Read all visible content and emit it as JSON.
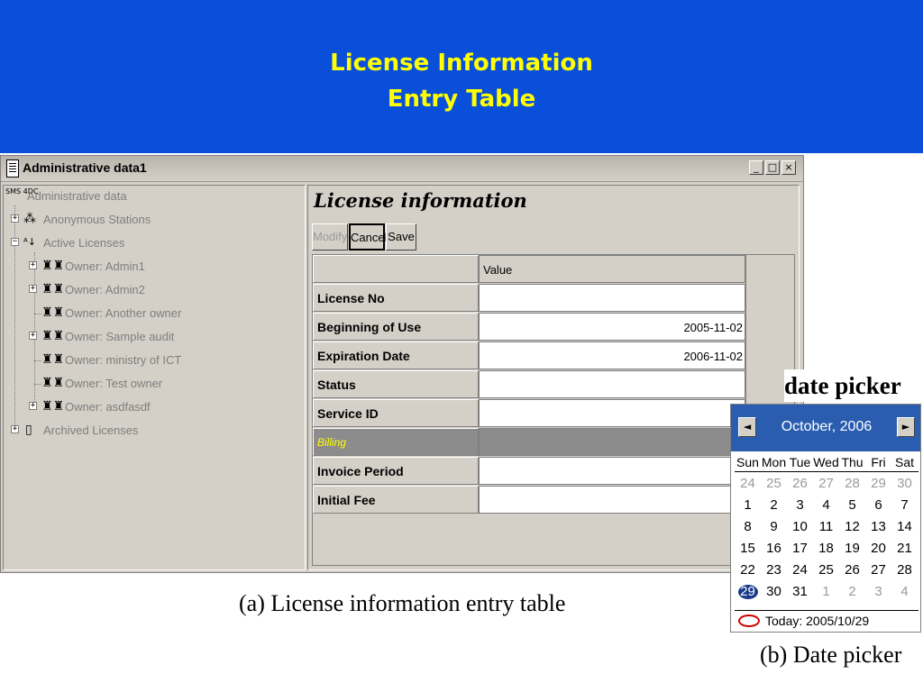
{
  "slide": {
    "title_line1": "License Information",
    "title_line2": "Entry Table",
    "header_color": "#0a4fd9",
    "title_color": "#ffff00"
  },
  "window": {
    "title": "Administrative data1",
    "controls": {
      "minimize": "_",
      "maximize": "□",
      "close": "×"
    }
  },
  "tree": {
    "root_icon_text": "SMS 4DC",
    "root": "Administrative data",
    "nodes": [
      {
        "label": "Anonymous Stations",
        "icon": "stations-icon",
        "expander": "+"
      },
      {
        "label": "Active Licenses",
        "icon": "active-licenses-icon",
        "expander": "−"
      },
      {
        "label": "Owner: Admin1",
        "icon": "owner-icon",
        "expander": "+"
      },
      {
        "label": "Owner: Admin2",
        "icon": "owner-icon",
        "expander": "+"
      },
      {
        "label": "Owner: Another owner",
        "icon": "owner-icon",
        "expander": ""
      },
      {
        "label": "Owner: Sample audit",
        "icon": "owner-icon",
        "expander": "+"
      },
      {
        "label": "Owner: ministry of ICT",
        "icon": "owner-icon",
        "expander": ""
      },
      {
        "label": "Owner: Test owner",
        "icon": "owner-icon",
        "expander": ""
      },
      {
        "label": "Owner: asdfasdf",
        "icon": "owner-icon",
        "expander": "+"
      },
      {
        "label": "Archived Licenses",
        "icon": "archive-icon",
        "expander": "+"
      }
    ]
  },
  "panel": {
    "title": "License information",
    "buttons": {
      "modify": "Modify",
      "cancel": "Cancel",
      "save": "Save"
    },
    "column_header": "Value",
    "rows": [
      {
        "label": "License No",
        "value": ""
      },
      {
        "label": "Beginning of Use",
        "value": "2005-11-02"
      },
      {
        "label": "Expiration Date",
        "value": "2006-11-02"
      },
      {
        "label": "Status",
        "value": ""
      },
      {
        "label": "Service ID",
        "value": ""
      },
      {
        "label": "Billing",
        "value": "",
        "section": true
      },
      {
        "label": "Invoice Period",
        "value": ""
      },
      {
        "label": "Initial Fee",
        "value": ""
      }
    ]
  },
  "captions": {
    "a": "(a) License information entry table",
    "b": "(b) Date picker",
    "date_picker_label": "date picker"
  },
  "datepicker": {
    "month": "October, 2006",
    "prev": "◄",
    "next": "►",
    "weekdays": [
      "Sun",
      "Mon",
      "Tue",
      "Wed",
      "Thu",
      "Fri",
      "Sat"
    ],
    "weeks": [
      [
        "24",
        "25",
        "26",
        "27",
        "28",
        "29",
        "30"
      ],
      [
        "1",
        "2",
        "3",
        "4",
        "5",
        "6",
        "7"
      ],
      [
        "8",
        "9",
        "10",
        "11",
        "12",
        "13",
        "14"
      ],
      [
        "15",
        "16",
        "17",
        "18",
        "19",
        "20",
        "21"
      ],
      [
        "22",
        "23",
        "24",
        "25",
        "26",
        "27",
        "28"
      ],
      [
        "29",
        "30",
        "31",
        "1",
        "2",
        "3",
        "4"
      ]
    ],
    "muted_weeks": [
      [
        true,
        true,
        true,
        true,
        true,
        true,
        true
      ],
      [
        false,
        false,
        false,
        false,
        false,
        false,
        false
      ],
      [
        false,
        false,
        false,
        false,
        false,
        false,
        false
      ],
      [
        false,
        false,
        false,
        false,
        false,
        false,
        false
      ],
      [
        false,
        false,
        false,
        false,
        false,
        false,
        false
      ],
      [
        false,
        false,
        false,
        true,
        true,
        true,
        true
      ]
    ],
    "selected": "29",
    "today": "Today: 2005/10/29"
  }
}
